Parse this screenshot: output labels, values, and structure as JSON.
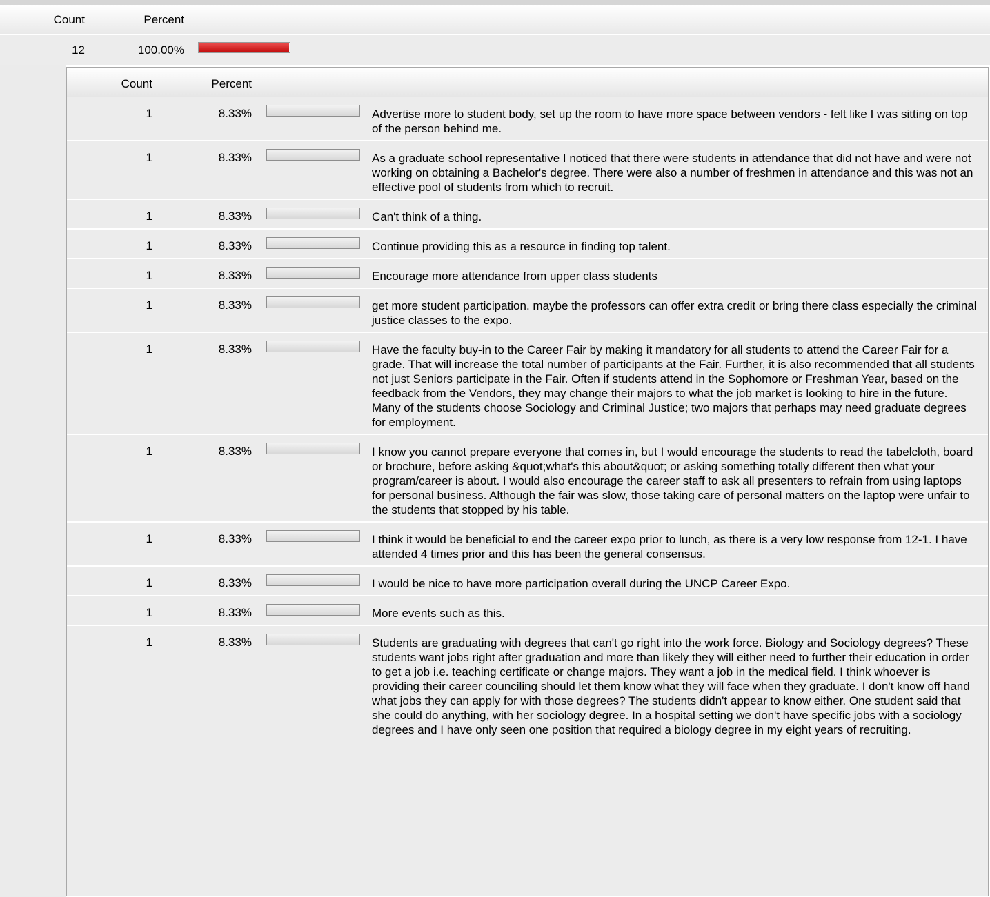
{
  "outer": {
    "headers": {
      "count": "Count",
      "percent": "Percent"
    },
    "row": {
      "count": "12",
      "percent": "100.00%",
      "bar_fraction": 1.0
    }
  },
  "inner": {
    "headers": {
      "count": "Count",
      "percent": "Percent"
    },
    "rows": [
      {
        "count": "1",
        "percent": "8.33%",
        "bar_fraction": 0.0833,
        "text": "Advertise more to student body, set up the room to have more space between vendors - felt like I was sitting on top of the person behind me."
      },
      {
        "count": "1",
        "percent": "8.33%",
        "bar_fraction": 0.0833,
        "text": "As a graduate school representative I noticed that there were students in attendance that did not have and were not working on obtaining a Bachelor's degree. There were also a number of freshmen in attendance and this was not an effective pool of students from which to recruit."
      },
      {
        "count": "1",
        "percent": "8.33%",
        "bar_fraction": 0.0833,
        "text": "Can't think of a thing."
      },
      {
        "count": "1",
        "percent": "8.33%",
        "bar_fraction": 0.0833,
        "text": "Continue providing this as a resource in finding top talent."
      },
      {
        "count": "1",
        "percent": "8.33%",
        "bar_fraction": 0.0833,
        "text": "Encourage more attendance from upper class students"
      },
      {
        "count": "1",
        "percent": "8.33%",
        "bar_fraction": 0.0833,
        "text": "get more student participation. maybe the professors can offer extra credit or bring there class especially the criminal justice classes to the expo."
      },
      {
        "count": "1",
        "percent": "8.33%",
        "bar_fraction": 0.0833,
        "text": "Have the faculty buy-in to the Career Fair by making it mandatory for all students to attend the Career Fair for a grade. That will increase the total number of participants at the Fair. Further, it is also recommended that all students not just Seniors participate in the Fair. Often if students attend in the Sophomore or Freshman Year, based on the feedback from the Vendors, they may change their majors to what the job market is looking to hire in the future. Many of the students choose Sociology and Criminal Justice; two majors that perhaps may need graduate degrees for employment."
      },
      {
        "count": "1",
        "percent": "8.33%",
        "bar_fraction": 0.0833,
        "text": "I know you cannot prepare everyone that comes in, but I would encourage the students to read the tabelcloth, board or brochure, before asking &quot;what's this about&quot; or asking something totally different then what your program/career is about. I would also encourage the career staff to ask all presenters to refrain from using laptops for personal business. Although the fair was slow, those taking care of personal matters on the laptop were unfair to the students that stopped by his table."
      },
      {
        "count": "1",
        "percent": "8.33%",
        "bar_fraction": 0.0833,
        "text": "I think it would be beneficial to end the career expo prior to lunch, as there is a very low response from 12-1. I have attended 4 times prior and this has been the general consensus."
      },
      {
        "count": "1",
        "percent": "8.33%",
        "bar_fraction": 0.0833,
        "text": "I would be nice to have more participation overall during the UNCP Career Expo."
      },
      {
        "count": "1",
        "percent": "8.33%",
        "bar_fraction": 0.0833,
        "text": "More events such as this."
      },
      {
        "count": "1",
        "percent": "8.33%",
        "bar_fraction": 0.0833,
        "text": "Students are graduating with degrees that can't go right into the work force. Biology and Sociology degrees? These students want jobs right after graduation and more than likely they will either need to further their education in order to get a job i.e. teaching certificate or change majors. They want a job in the medical field. I think whoever is providing their career counciling should let them know what they will face when they graduate. I don't know off hand what jobs they can apply for with those degrees? The students didn't appear to know either. One student said that she could do anything, with her sociology degree. In a hospital setting we don't have specific jobs with a sociology degrees and I have only seen one position that required a biology degree in my eight years of recruiting."
      }
    ]
  }
}
